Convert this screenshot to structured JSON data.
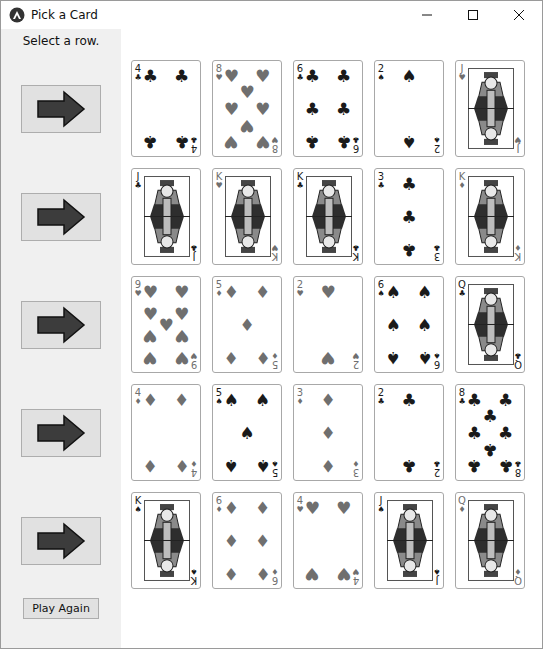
{
  "window": {
    "title": "Pick a Card"
  },
  "sidebar": {
    "prompt": "Select a row.",
    "play_again": "Play Again"
  },
  "rows": [
    {
      "cards": [
        {
          "rank": "4",
          "suit": "♣",
          "color": "#1a1a1a"
        },
        {
          "rank": "8",
          "suit": "♥",
          "color": "#6f6f6f"
        },
        {
          "rank": "6",
          "suit": "♣",
          "color": "#1a1a1a"
        },
        {
          "rank": "2",
          "suit": "♠",
          "color": "#1a1a1a"
        },
        {
          "rank": "J",
          "suit": "♥",
          "color": "#6f6f6f"
        }
      ]
    },
    {
      "cards": [
        {
          "rank": "J",
          "suit": "♣",
          "color": "#1a1a1a"
        },
        {
          "rank": "K",
          "suit": "♥",
          "color": "#6f6f6f"
        },
        {
          "rank": "K",
          "suit": "♣",
          "color": "#1a1a1a"
        },
        {
          "rank": "3",
          "suit": "♣",
          "color": "#1a1a1a"
        },
        {
          "rank": "K",
          "suit": "♦",
          "color": "#6f6f6f"
        }
      ]
    },
    {
      "cards": [
        {
          "rank": "9",
          "suit": "♥",
          "color": "#6f6f6f"
        },
        {
          "rank": "5",
          "suit": "♦",
          "color": "#6f6f6f"
        },
        {
          "rank": "2",
          "suit": "♥",
          "color": "#6f6f6f"
        },
        {
          "rank": "6",
          "suit": "♠",
          "color": "#1a1a1a"
        },
        {
          "rank": "Q",
          "suit": "♣",
          "color": "#1a1a1a"
        }
      ]
    },
    {
      "cards": [
        {
          "rank": "4",
          "suit": "♦",
          "color": "#6f6f6f"
        },
        {
          "rank": "5",
          "suit": "♠",
          "color": "#1a1a1a"
        },
        {
          "rank": "3",
          "suit": "♦",
          "color": "#6f6f6f"
        },
        {
          "rank": "2",
          "suit": "♣",
          "color": "#1a1a1a"
        },
        {
          "rank": "8",
          "suit": "♣",
          "color": "#1a1a1a"
        }
      ]
    },
    {
      "cards": [
        {
          "rank": "K",
          "suit": "♠",
          "color": "#1a1a1a"
        },
        {
          "rank": "6",
          "suit": "♦",
          "color": "#6f6f6f"
        },
        {
          "rank": "4",
          "suit": "♥",
          "color": "#6f6f6f"
        },
        {
          "rank": "J",
          "suit": "♠",
          "color": "#1a1a1a"
        },
        {
          "rank": "Q",
          "suit": "♦",
          "color": "#6f6f6f"
        }
      ]
    }
  ]
}
